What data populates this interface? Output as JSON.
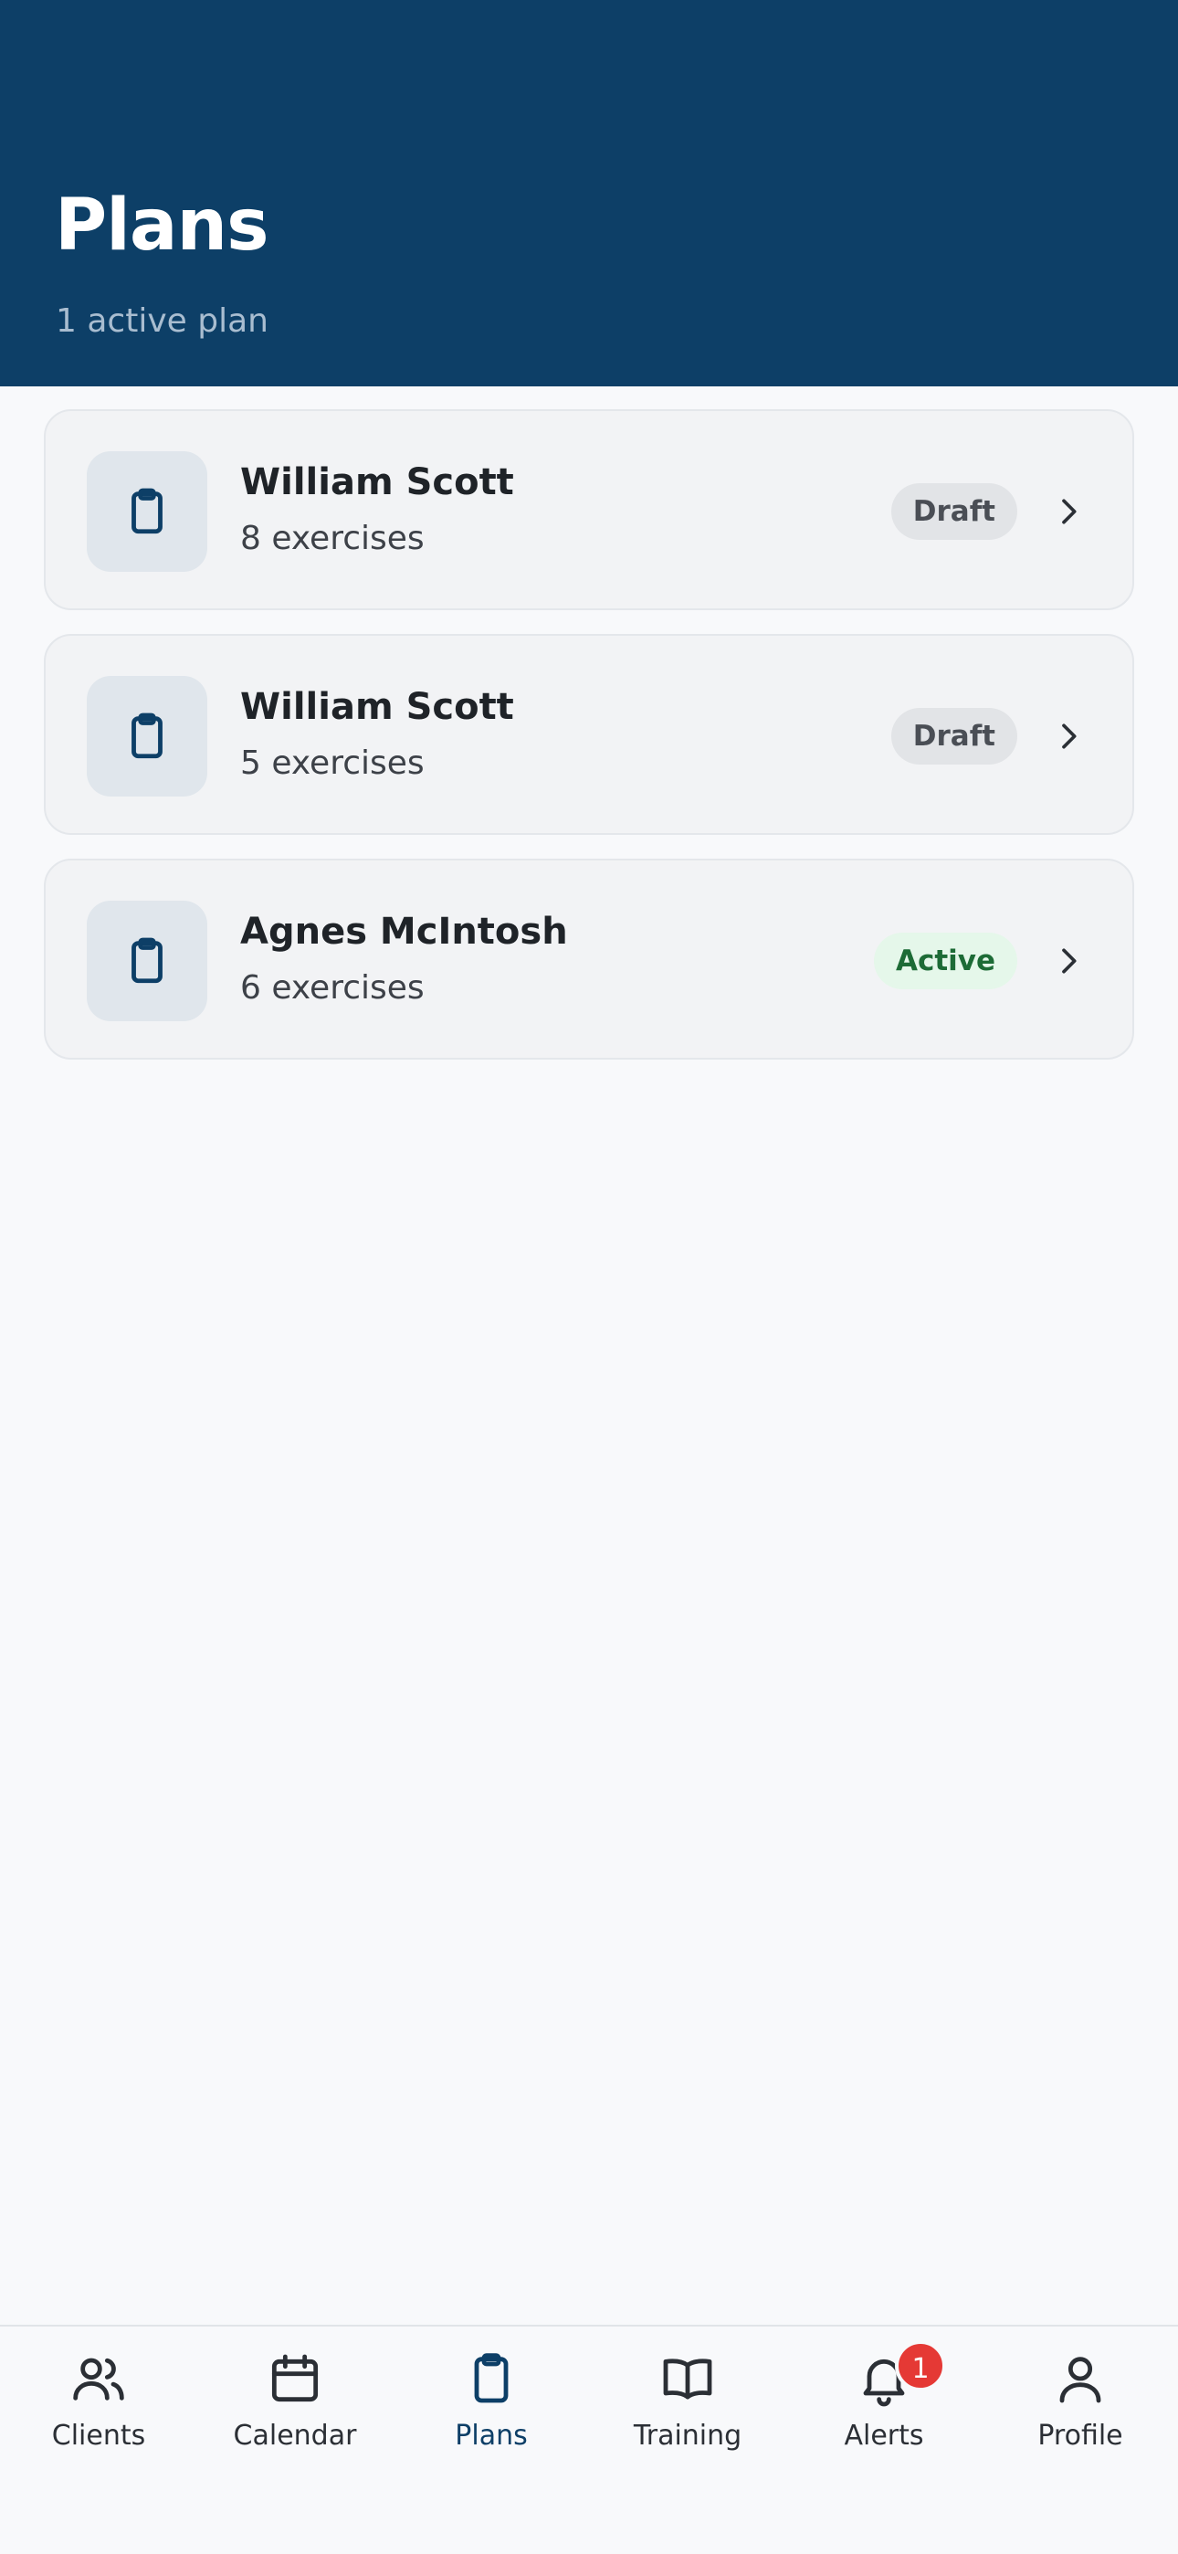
{
  "header": {
    "title": "Plans",
    "subtitle": "1 active plan"
  },
  "plans": [
    {
      "name": "William Scott",
      "exercises": "8 exercises",
      "status": "Draft",
      "icon": "clipboard-icon"
    },
    {
      "name": "William Scott",
      "exercises": "5 exercises",
      "status": "Draft",
      "icon": "clipboard-icon"
    },
    {
      "name": "Agnes McIntosh",
      "exercises": "6 exercises",
      "status": "Active",
      "icon": "clipboard-icon"
    }
  ],
  "tabbar": {
    "items": [
      {
        "label": "Clients",
        "icon": "users-icon"
      },
      {
        "label": "Calendar",
        "icon": "calendar-icon"
      },
      {
        "label": "Plans",
        "icon": "clipboard-icon",
        "selected": true
      },
      {
        "label": "Training",
        "icon": "book-icon"
      },
      {
        "label": "Alerts",
        "icon": "bell-icon",
        "badge": "1"
      },
      {
        "label": "Profile",
        "icon": "user-icon"
      }
    ]
  },
  "colors": {
    "header_bg": "#0d3f67",
    "accent": "#0d3f67",
    "active_badge_bg": "#e5f7ea",
    "active_badge_text": "#1d6b36",
    "draft_badge_bg": "#e2e4e7",
    "alert_badge": "#e53935"
  }
}
